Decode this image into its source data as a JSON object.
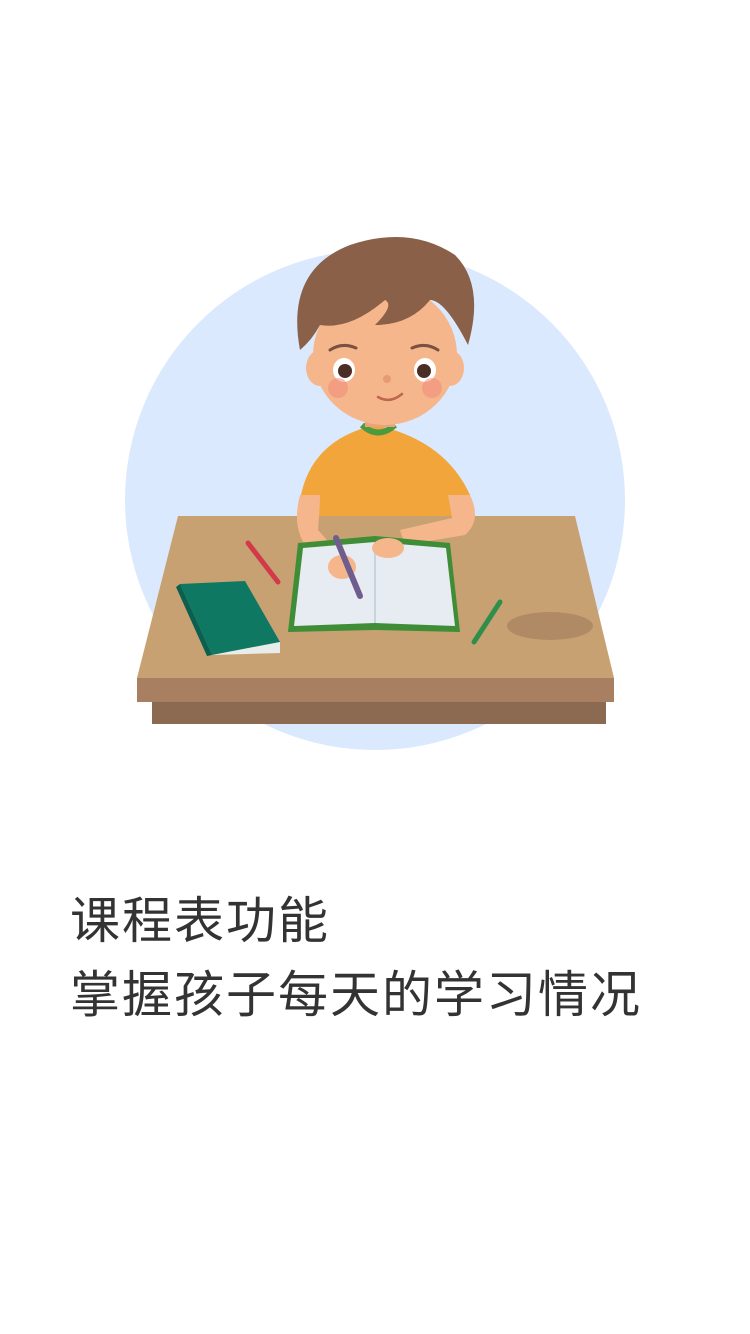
{
  "intro": {
    "title_line": "课程表功能",
    "subtitle_line": "掌握孩子每天的学习情况"
  },
  "illustration": {
    "icon": "boy-studying-at-desk-illustration",
    "colors": {
      "circle": "#dae9fe",
      "shirt": "#f1a53a",
      "skin": "#f6b68c",
      "hair": "#8a6048",
      "desk_top": "#c8a173",
      "desk_edge": "#a87f61",
      "desk_front": "#8c6a52",
      "book": "#0f7862",
      "notebook_cover": "#3f8d36"
    }
  }
}
